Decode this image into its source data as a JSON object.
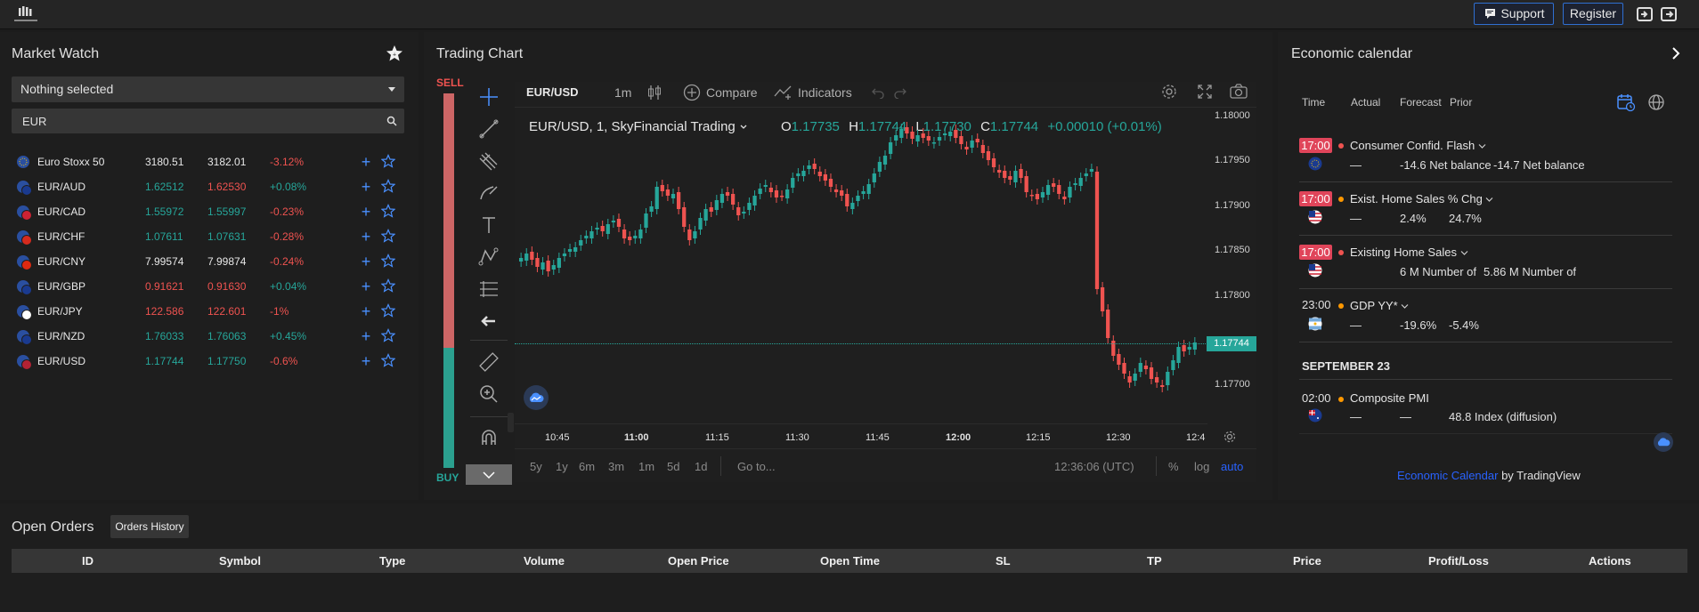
{
  "topbar": {
    "logo_icon": "brand-logo-icon",
    "support_label": "Support",
    "register_label": "Register",
    "icons": [
      "login-icon",
      "logout-icon"
    ]
  },
  "market_watch": {
    "title": "Market Watch",
    "select_value": "Nothing selected",
    "search_value": "EUR",
    "rows": [
      {
        "symbol": "Euro Stoxx 50",
        "bid": "3180.51",
        "ask": "3182.01",
        "change": "-3.12%",
        "bid_color": "white",
        "ask_color": "white",
        "change_color": "red"
      },
      {
        "symbol": "EUR/AUD",
        "bid": "1.62512",
        "ask": "1.62530",
        "change": "+0.08%",
        "bid_color": "green",
        "ask_color": "red",
        "change_color": "green"
      },
      {
        "symbol": "EUR/CAD",
        "bid": "1.55972",
        "ask": "1.55997",
        "change": "-0.23%",
        "bid_color": "green",
        "ask_color": "green",
        "change_color": "red"
      },
      {
        "symbol": "EUR/CHF",
        "bid": "1.07611",
        "ask": "1.07631",
        "change": "-0.28%",
        "bid_color": "green",
        "ask_color": "green",
        "change_color": "red"
      },
      {
        "symbol": "EUR/CNY",
        "bid": "7.99574",
        "ask": "7.99874",
        "change": "-0.24%",
        "bid_color": "white",
        "ask_color": "white",
        "change_color": "red"
      },
      {
        "symbol": "EUR/GBP",
        "bid": "0.91621",
        "ask": "0.91630",
        "change": "+0.04%",
        "bid_color": "red",
        "ask_color": "red",
        "change_color": "green"
      },
      {
        "symbol": "EUR/JPY",
        "bid": "122.586",
        "ask": "122.601",
        "change": "-1%",
        "bid_color": "red",
        "ask_color": "red",
        "change_color": "red"
      },
      {
        "symbol": "EUR/NZD",
        "bid": "1.76033",
        "ask": "1.76063",
        "change": "+0.45%",
        "bid_color": "green",
        "ask_color": "green",
        "change_color": "green"
      },
      {
        "symbol": "EUR/USD",
        "bid": "1.17744",
        "ask": "1.17750",
        "change": "-0.6%",
        "bid_color": "green",
        "ask_color": "green",
        "change_color": "red"
      }
    ],
    "colors": {
      "white": "#e8e8e8",
      "green": "#26a69a",
      "red": "#ef5350"
    }
  },
  "trading_chart": {
    "title": "Trading Chart",
    "sell_label": "SELL",
    "buy_label": "BUY",
    "symbol": "EUR/USD",
    "interval": "1m",
    "compare_label": "Compare",
    "indicators_label": "Indicators",
    "legend_title": "EUR/USD, 1, SkyFinancial Trading",
    "ohlc": {
      "o_label": "O",
      "o": "1.17735",
      "h_label": "H",
      "h": "1.17744",
      "l_label": "L",
      "l": "1.17730",
      "c_label": "C",
      "c": "1.17744",
      "change": "+0.00010 (+0.01%)"
    },
    "price_axis": [
      "1.18000",
      "1.17950",
      "1.17900",
      "1.17850",
      "1.17800",
      "1.17744",
      "1.17700"
    ],
    "current_price": "1.17744",
    "time_axis": [
      "10:45",
      "11:00",
      "11:15",
      "11:30",
      "11:45",
      "12:00",
      "12:15",
      "12:30",
      "12:4"
    ],
    "ranges": [
      "5y",
      "1y",
      "6m",
      "3m",
      "1m",
      "5d",
      "1d"
    ],
    "goto_label": "Go to...",
    "clock": "12:36:06 (UTC)",
    "scale_options": [
      "%",
      "log",
      "auto"
    ],
    "accent_color": "#2962ff"
  },
  "economic_calendar": {
    "title": "Economic calendar",
    "columns": [
      "Time",
      "Actual",
      "Forecast",
      "Prior"
    ],
    "events": [
      {
        "time": "17:00",
        "title": "Consumer Confid. Flash",
        "flag": "eu-flag-icon",
        "actual": "—",
        "forecast": "-14.6 Net balance",
        "prior": "-14.7 Net balance",
        "dot_color": "#ef5350",
        "highlight": true
      },
      {
        "time": "17:00",
        "title": "Exist. Home Sales % Chg",
        "flag": "us-flag-icon",
        "actual": "—",
        "forecast": "2.4%",
        "prior": "24.7%",
        "dot_color": "#ff9800",
        "highlight": true
      },
      {
        "time": "17:00",
        "title": "Existing Home Sales",
        "flag": "us-flag-icon",
        "actual": "",
        "forecast": "6 M Number of",
        "prior": "5.86 M Number of",
        "dot_color": "#ef5350",
        "highlight": true
      },
      {
        "time": "23:00",
        "title": "GDP YY*",
        "flag": "ar-flag-icon",
        "actual": "—",
        "forecast": "-19.6%",
        "prior": "-5.4%",
        "dot_color": "#ff9800",
        "highlight": false
      }
    ],
    "date_header": "SEPTEMBER 23",
    "later_event": {
      "time": "02:00",
      "title": "Composite PMI",
      "flag": "au-flag-icon",
      "actual": "—",
      "forecast": "—",
      "prior": "48.8 Index (diffusion)",
      "dot_color": "#ff9800"
    },
    "footer_link": "Economic Calendar",
    "footer_suffix": " by TradingView"
  },
  "orders": {
    "title": "Open Orders",
    "history_tab": "Orders History",
    "columns": [
      "ID",
      "Symbol",
      "Type",
      "Volume",
      "Open Price",
      "Open Time",
      "SL",
      "TP",
      "Price",
      "Profit/Loss",
      "Actions"
    ]
  }
}
